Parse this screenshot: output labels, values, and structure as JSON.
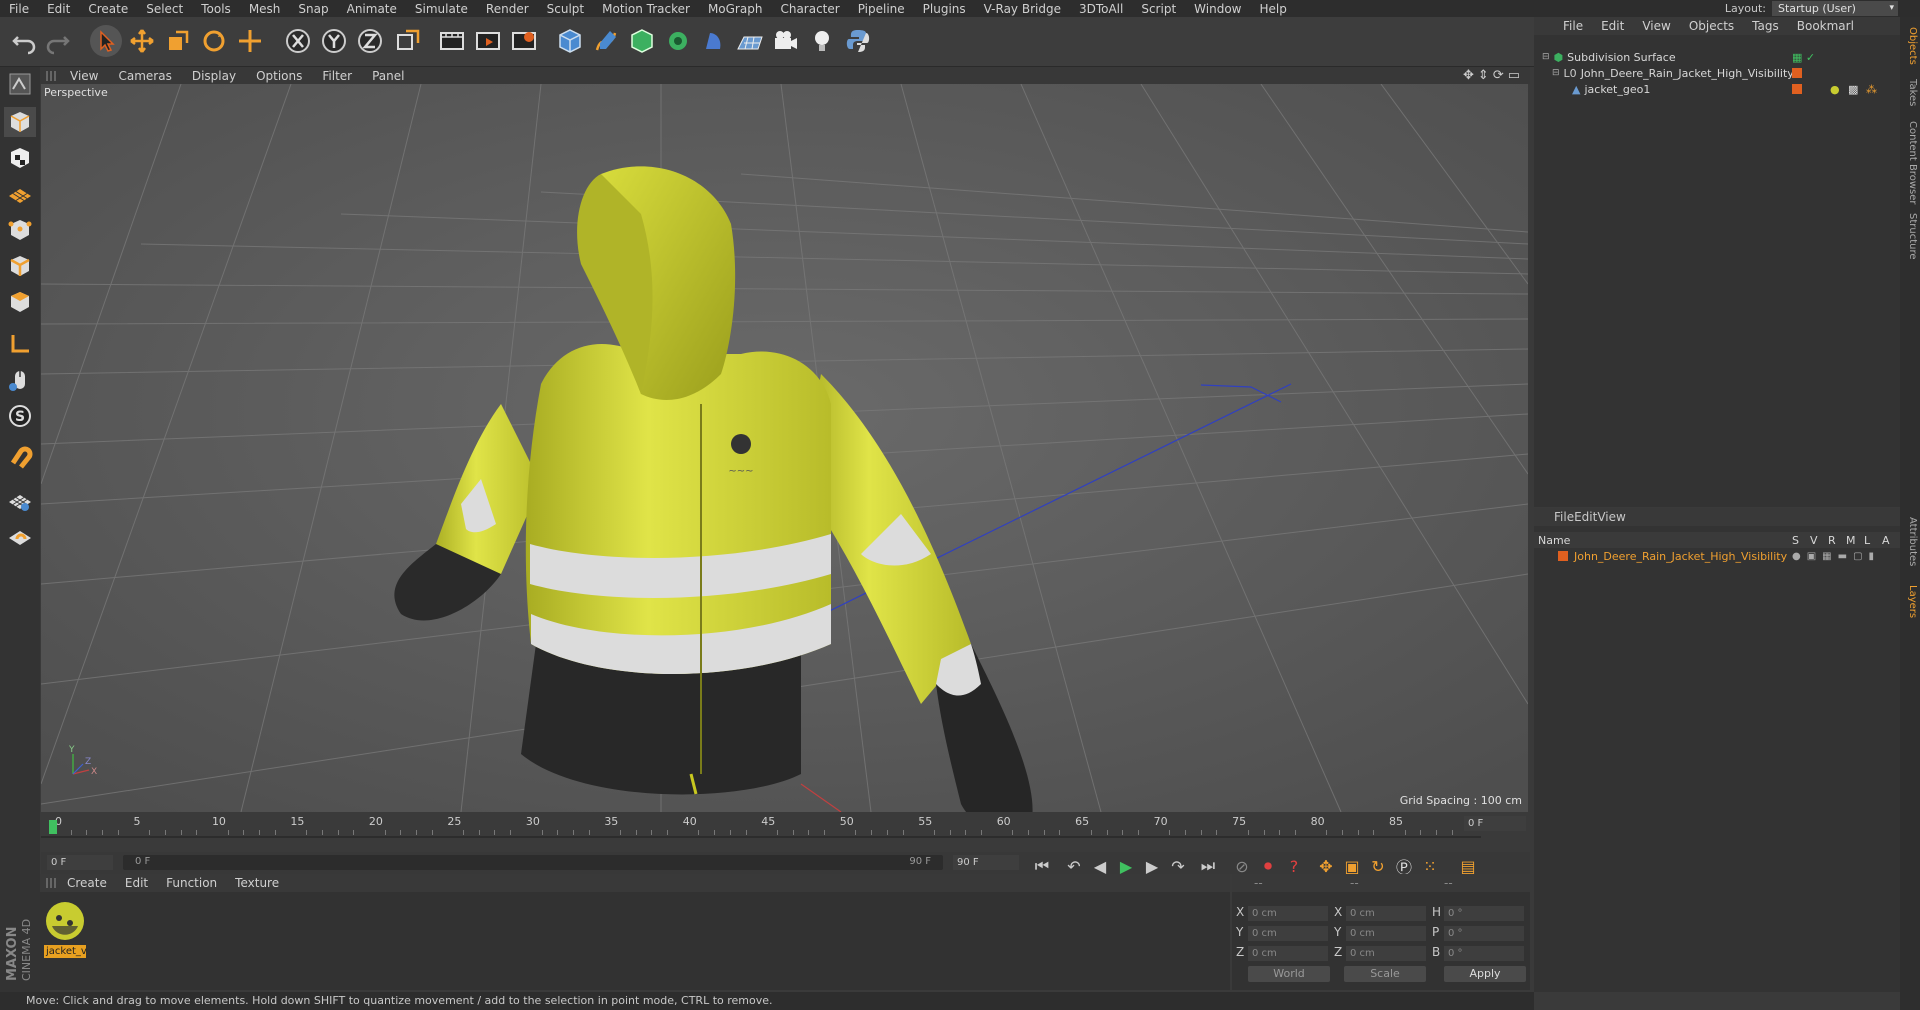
{
  "menu": {
    "items": [
      "File",
      "Edit",
      "Create",
      "Select",
      "Tools",
      "Mesh",
      "Snap",
      "Animate",
      "Simulate",
      "Render",
      "Sculpt",
      "Motion Tracker",
      "MoGraph",
      "Character",
      "Pipeline",
      "Plugins",
      "V-Ray Bridge",
      "3DToAll",
      "Script",
      "Window",
      "Help"
    ]
  },
  "layout": {
    "label": "Layout:",
    "value": "Startup (User)"
  },
  "viewport": {
    "menu": [
      "View",
      "Cameras",
      "Display",
      "Options",
      "Filter",
      "Panel"
    ],
    "label": "Perspective",
    "grid_spacing": "Grid Spacing : 100 cm",
    "axis": {
      "y": "Y",
      "x": "X",
      "z": "Z"
    }
  },
  "timeline": {
    "ticks": [
      "0",
      "5",
      "10",
      "15",
      "20",
      "25",
      "30",
      "35",
      "40",
      "45",
      "50",
      "55",
      "60",
      "65",
      "70",
      "75",
      "80",
      "85",
      "90"
    ],
    "current_frame": "0 F",
    "start_field": "0 F",
    "range_start": "0 F",
    "range_end": "90 F",
    "end_field": "90 F"
  },
  "material_manager": {
    "menu": [
      "Create",
      "Edit",
      "Function",
      "Texture"
    ],
    "material_name": "jacket_v"
  },
  "coordinates": {
    "headers": [
      "--",
      "--",
      "--"
    ],
    "rows": [
      {
        "a": "X",
        "av": "0 cm",
        "b": "X",
        "bv": "0 cm",
        "c": "H",
        "cv": "0 °"
      },
      {
        "a": "Y",
        "av": "0 cm",
        "b": "Y",
        "bv": "0 cm",
        "c": "P",
        "cv": "0 °"
      },
      {
        "a": "Z",
        "av": "0 cm",
        "b": "Z",
        "bv": "0 cm",
        "c": "B",
        "cv": "0 °"
      }
    ],
    "mode": "World",
    "scale": "Scale",
    "apply": "Apply"
  },
  "status": "Move: Click and drag to move elements. Hold down SHIFT to quantize movement / add to the selection in point mode, CTRL to remove.",
  "object_manager": {
    "menu": [
      "File",
      "Edit",
      "View",
      "Objects",
      "Tags",
      "Bookmarl"
    ],
    "objects": [
      {
        "name": "Subdivision Surface",
        "indent": 0
      },
      {
        "name": "John_Deere_Rain_Jacket_High_Visibility",
        "indent": 1
      },
      {
        "name": "jacket_geo1",
        "indent": 2
      }
    ]
  },
  "layer_manager": {
    "menu": [
      "File",
      "Edit",
      "View"
    ],
    "columns": {
      "name": "Name",
      "flags": [
        "S",
        "V",
        "R",
        "M",
        "L",
        "A"
      ]
    },
    "layers": [
      {
        "name": "John_Deere_Rain_Jacket_High_Visibility"
      }
    ]
  },
  "side_tabs": [
    "Objects",
    "Takes",
    "Content Browser",
    "Structure",
    "Attributes",
    "Layers"
  ],
  "brand": {
    "maxon": "MAXON",
    "product": "CINEMA 4D"
  },
  "colors": {
    "accent": "#f0a030",
    "jacket_yellow": "#d4d83a",
    "active": "#e8a020"
  }
}
